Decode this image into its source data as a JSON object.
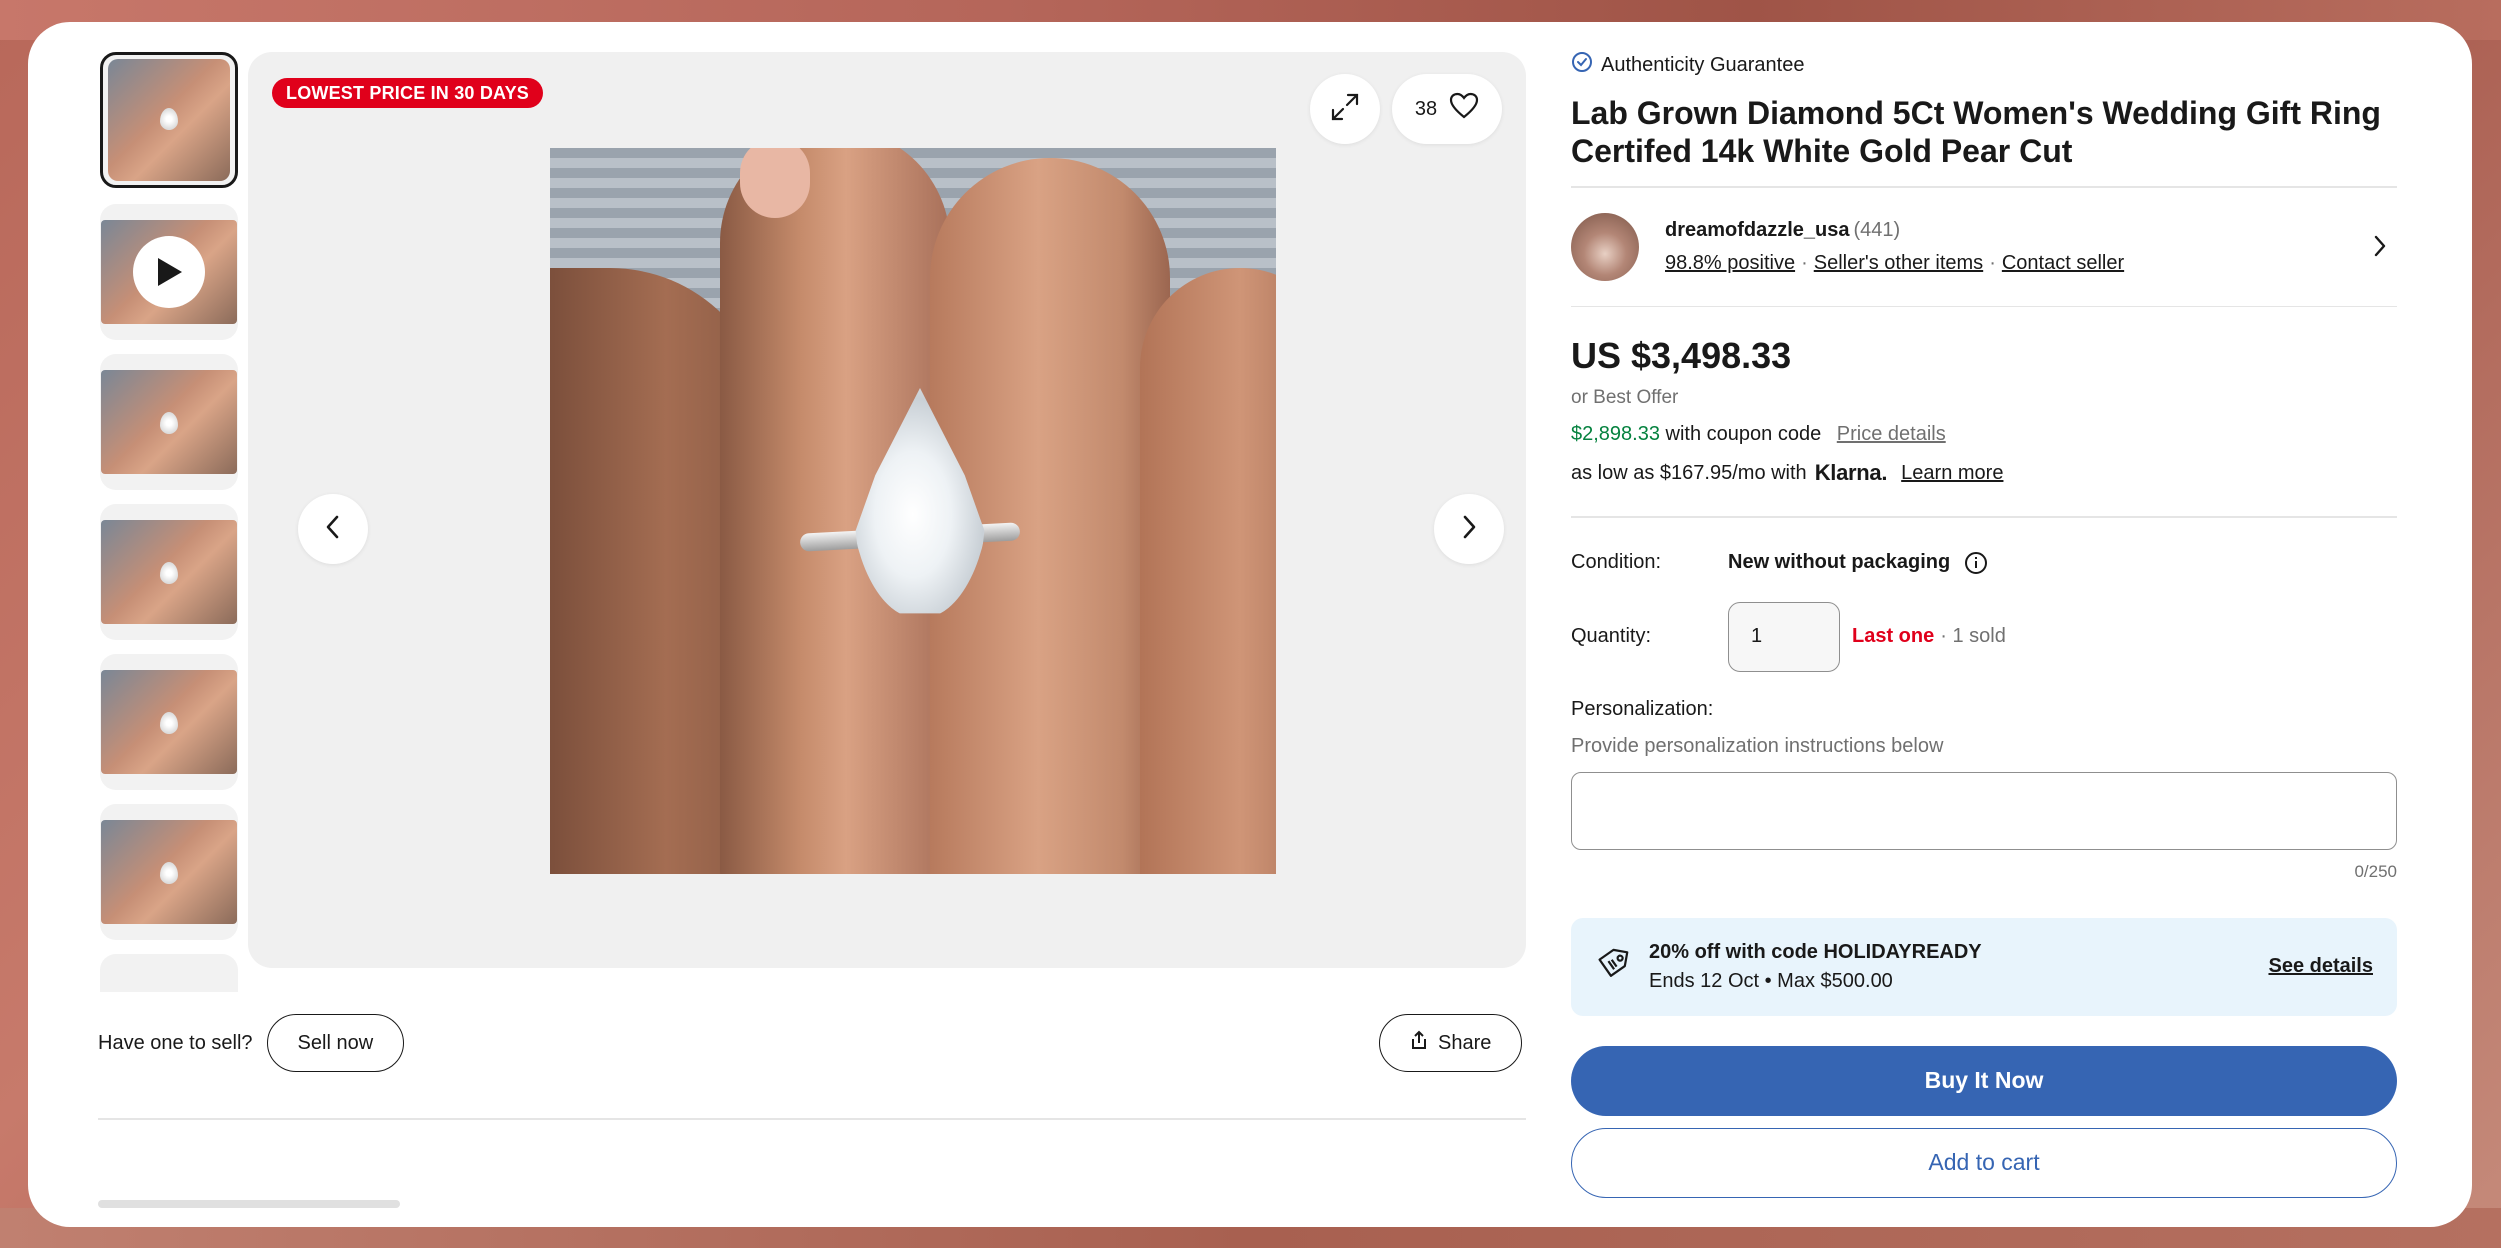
{
  "gallery": {
    "badge": "LOWEST PRICE IN 30 DAYS",
    "watch_count": "38"
  },
  "sell": {
    "prompt": "Have one to sell?",
    "button": "Sell now",
    "share": "Share"
  },
  "listing": {
    "authenticity": "Authenticity Guarantee",
    "title": "Lab Grown Diamond 5Ct Women's Wedding Gift Ring Certifed 14k White Gold Pear Cut"
  },
  "seller": {
    "name": "dreamofdazzle_usa",
    "feedback_count": "(441)",
    "positive": "98.8% positive",
    "other_items": "Seller's other items",
    "contact": "Contact seller"
  },
  "price": {
    "main": "US $3,498.33",
    "best_offer": "or Best Offer",
    "coupon_price": "$2,898.33",
    "coupon_text": "with coupon code",
    "price_details": "Price details",
    "klarna_prefix": "as low as $167.95/mo with",
    "klarna_brand": "Klarna.",
    "learn_more": "Learn more"
  },
  "specs": {
    "condition_label": "Condition:",
    "condition_value": "New without packaging",
    "quantity_label": "Quantity:",
    "quantity_value": "1",
    "last_one": "Last one",
    "sold": "· 1 sold"
  },
  "personalization": {
    "label": "Personalization:",
    "hint": "Provide personalization instructions below",
    "counter": "0/250"
  },
  "promo": {
    "title": "20% off with code HOLIDAYREADY",
    "subtitle": "Ends 12 Oct • Max $500.00",
    "link": "See details"
  },
  "actions": {
    "buy_now": "Buy It Now",
    "add_to_cart": "Add to cart"
  }
}
